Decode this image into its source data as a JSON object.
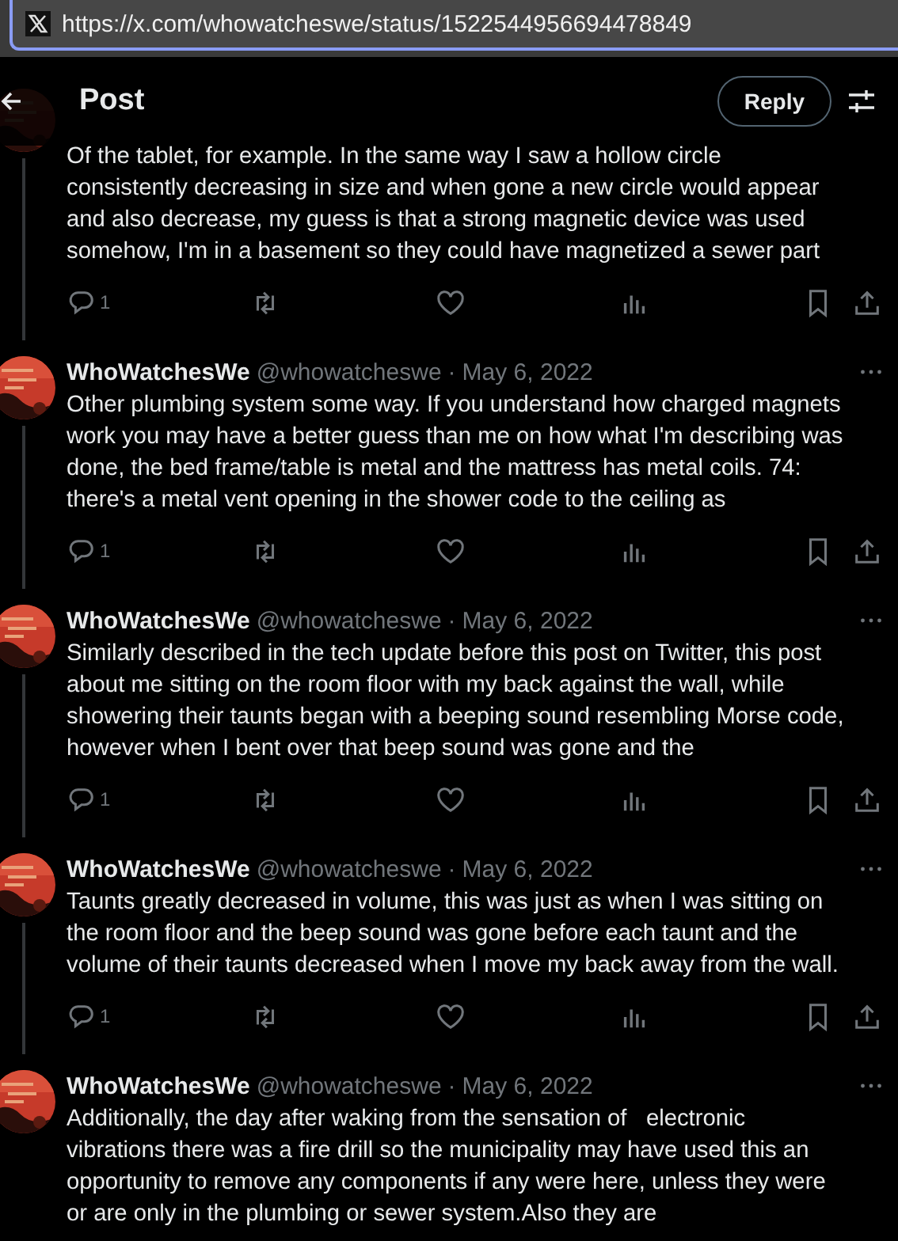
{
  "address_bar": {
    "url": "https://x.com/whowatcheswe/status/1522544956694478849"
  },
  "header": {
    "title": "Post",
    "reply_button": "Reply"
  },
  "posts": [
    {
      "text": "Of the tablet, for example. In the same way I saw a hollow circle consistently decreasing in size and when gone a new circle would appear and also decrease, my guess is that a strong magnetic device was used somehow, I'm in a basement so they could have magnetized a sewer part",
      "reply_count": "1"
    },
    {
      "author": {
        "name": "WhoWatchesWe",
        "handle": "@whowatcheswe",
        "date": "May 6, 2022",
        "separator": "·"
      },
      "text": "Other plumbing system some way. If you understand how charged magnets work you may have a better guess than me on how what I'm describing was done, the bed frame/table is metal and the mattress has metal coils. 74: there's a metal vent opening in the shower code to the ceiling as",
      "reply_count": "1"
    },
    {
      "author": {
        "name": "WhoWatchesWe",
        "handle": "@whowatcheswe",
        "date": "May 6, 2022",
        "separator": "·"
      },
      "text": "Similarly described in the tech update before this post on Twitter, this post about me sitting on the room floor with my back against the wall, while showering their taunts began with a beeping sound resembling Morse code, however when I bent over that beep sound was gone and the",
      "reply_count": "1"
    },
    {
      "author": {
        "name": "WhoWatchesWe",
        "handle": "@whowatcheswe",
        "date": "May 6, 2022",
        "separator": "·"
      },
      "text": "Taunts greatly decreased in volume, this was just as when I was sitting on the room floor and the beep sound was gone before each taunt and the volume of their taunts decreased when I move my back away from the wall.",
      "reply_count": "1"
    },
    {
      "author": {
        "name": "WhoWatchesWe",
        "handle": "@whowatcheswe",
        "date": "May 6, 2022",
        "separator": "·"
      },
      "text": "Additionally, the day after waking from the sensation of   electronic vibrations there was a fire drill so the municipality may have used this an opportunity to remove any components if any were here, unless they were or are only in the plumbing or sewer system.Also they are"
    }
  ]
}
